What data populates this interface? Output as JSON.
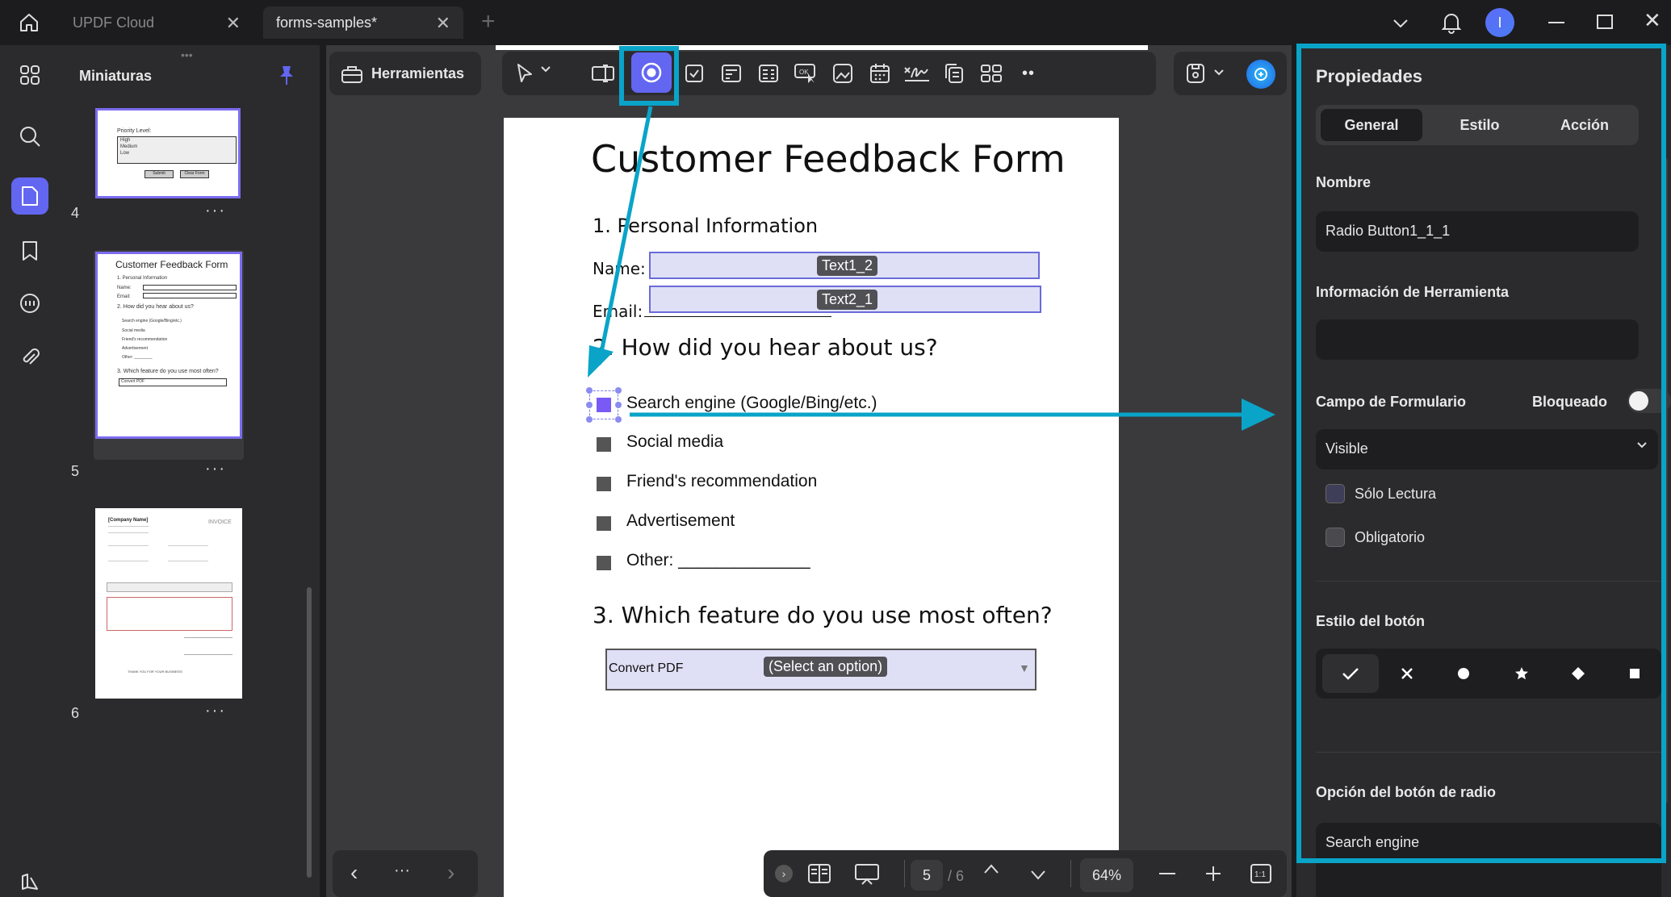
{
  "titlebar": {
    "tabs": [
      {
        "label": "UPDF Cloud"
      },
      {
        "label": "forms-samples*"
      }
    ],
    "avatar_letter": "I",
    "new_tab": "+"
  },
  "thumbnails": {
    "title": "Miniaturas",
    "pages": [
      {
        "number": "4",
        "more": "···"
      },
      {
        "number": "5",
        "more": "···"
      },
      {
        "number": "6",
        "more": "···"
      }
    ],
    "nav": {
      "more": "···"
    },
    "page4_snippet": {
      "priority_label": "Priority Level:",
      "options": [
        "High",
        "Medium",
        "Low"
      ],
      "submit": "Submit",
      "clear": "Clear Form"
    },
    "page5_snippet": {
      "title": "Customer Feedback Form",
      "lines": [
        "1. Personal Information",
        "Name:",
        "Email:",
        "2. How did you hear about us?",
        "Search engine (Google/Bing/etc.)",
        "Social media",
        "Friend's recommendation",
        "Advertisement",
        "Other: ________",
        "3. Which feature do you use most often?",
        "Convert PDF"
      ]
    },
    "page6_snippet": {
      "company": "[Company Name]",
      "invoice": "INVOICE",
      "thanks": "THANK YOU FOR YOUR BUSINESS!"
    }
  },
  "toolbar": {
    "tools_label": "Herramientas"
  },
  "document": {
    "title": "Customer Feedback Form",
    "section1": "1. Personal Information",
    "name_label": "Name:",
    "email_label": "Email:",
    "name_field": "Text1_2",
    "email_field": "Text2_1",
    "section2": "2. How did you hear about us?",
    "options": [
      "Search engine (Google/Bing/etc.)",
      "Social media",
      "Friend's recommendation",
      "Advertisement",
      "Other: ______________"
    ],
    "section3": "3. Which feature do you use most often?",
    "dropdown_value": "Convert PDF",
    "dropdown_tag": "(Select an option)"
  },
  "bottom_bar": {
    "current_page": "5",
    "total_pages": "/ 6",
    "zoom": "64%"
  },
  "properties": {
    "title": "Propiedades",
    "tabs": [
      "General",
      "Estilo",
      "Acción"
    ],
    "name_label": "Nombre",
    "name_value": "Radio Button1_1_1",
    "tooltip_label": "Información de Herramienta",
    "tooltip_value": "",
    "form_field_label": "Campo de Formulario",
    "locked_label": "Bloqueado",
    "visibility_value": "Visible",
    "readonly_label": "Sólo Lectura",
    "required_label": "Obligatorio",
    "button_style_label": "Estilo del botón",
    "radio_option_label": "Opción del botón de radio",
    "radio_option_value": "Search engine"
  },
  "colors": {
    "accent": "#6366f1",
    "highlight": "#0aa4c8",
    "field_fill": "#dfe0f6"
  }
}
